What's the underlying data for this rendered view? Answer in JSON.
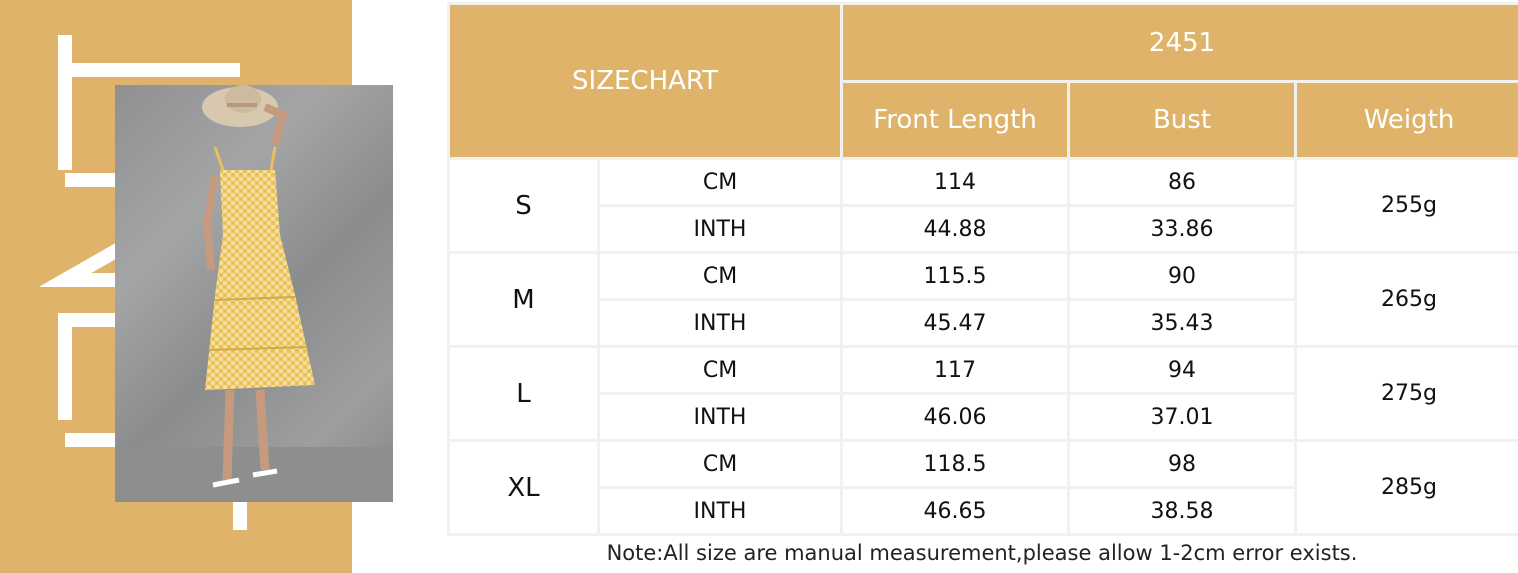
{
  "header": {
    "title": "SIZECHART",
    "model": "2451",
    "columns": [
      "Front Length",
      "Bust",
      "Weigth"
    ]
  },
  "rows": [
    {
      "size": "S",
      "cm": {
        "unit": "CM",
        "front_length": "114",
        "bust": "86"
      },
      "inch": {
        "unit": "INTH",
        "front_length": "44.88",
        "bust": "33.86"
      },
      "weight": "255g"
    },
    {
      "size": "M",
      "cm": {
        "unit": "CM",
        "front_length": "115.5",
        "bust": "90"
      },
      "inch": {
        "unit": "INTH",
        "front_length": "45.47",
        "bust": "35.43"
      },
      "weight": "265g"
    },
    {
      "size": "L",
      "cm": {
        "unit": "CM",
        "front_length": "117",
        "bust": "94"
      },
      "inch": {
        "unit": "INTH",
        "front_length": "46.06",
        "bust": "37.01"
      },
      "weight": "275g"
    },
    {
      "size": "XL",
      "cm": {
        "unit": "CM",
        "front_length": "118.5",
        "bust": "98"
      },
      "inch": {
        "unit": "INTH",
        "front_length": "46.65",
        "bust": "38.58"
      },
      "weight": "285g"
    }
  ],
  "note": "Note:All size are manual measurement,please allow 1-2cm error exists.",
  "colors": {
    "accent": "#dfb46a",
    "grid": "#f1f1f1"
  }
}
